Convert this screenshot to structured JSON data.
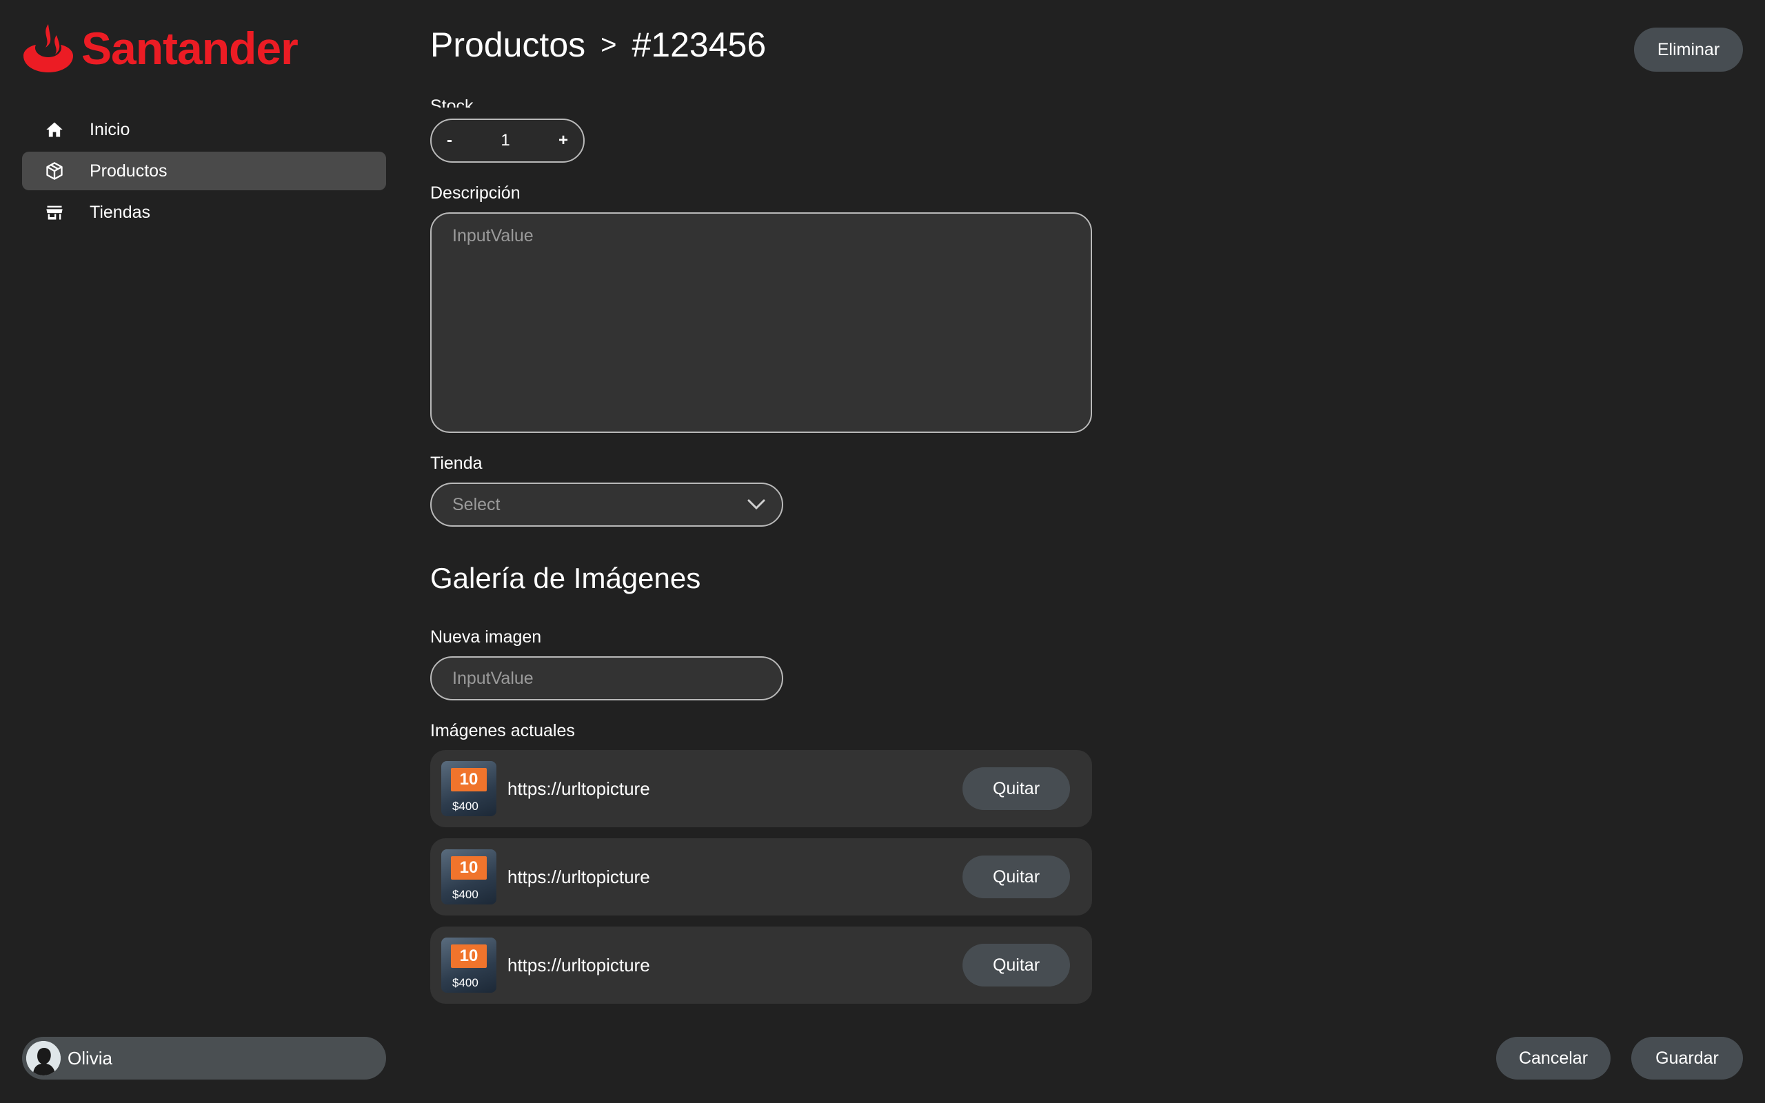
{
  "brand": {
    "name": "Santander",
    "color": "#EC1C24"
  },
  "sidebar": {
    "items": [
      {
        "label": "Inicio",
        "icon": "home-icon"
      },
      {
        "label": "Productos",
        "icon": "box-icon"
      },
      {
        "label": "Tiendas",
        "icon": "store-icon"
      }
    ],
    "active": "Productos"
  },
  "user": {
    "name": "Olivia"
  },
  "header": {
    "section": "Productos",
    "separator": ">",
    "id": "#123456"
  },
  "actions": {
    "delete_label": "Eliminar",
    "cancel_label": "Cancelar",
    "save_label": "Guardar"
  },
  "form": {
    "stock_label": "Stock",
    "stock": {
      "minus": "-",
      "value": "1",
      "plus": "+"
    },
    "description_label": "Descripción",
    "description_placeholder": "InputValue",
    "store_label": "Tienda",
    "store_placeholder": "Select"
  },
  "gallery": {
    "title": "Galería de Imágenes",
    "new_image_label": "Nueva imagen",
    "new_image_placeholder": "InputValue",
    "current_label": "Imágenes actuales",
    "images": [
      {
        "url": "https://urltopicture",
        "thumb_badge": "10",
        "thumb_price": "$400",
        "remove_label": "Quitar"
      },
      {
        "url": "https://urltopicture",
        "thumb_badge": "10",
        "thumb_price": "$400",
        "remove_label": "Quitar"
      },
      {
        "url": "https://urltopicture",
        "thumb_badge": "10",
        "thumb_price": "$400",
        "remove_label": "Quitar"
      }
    ]
  }
}
